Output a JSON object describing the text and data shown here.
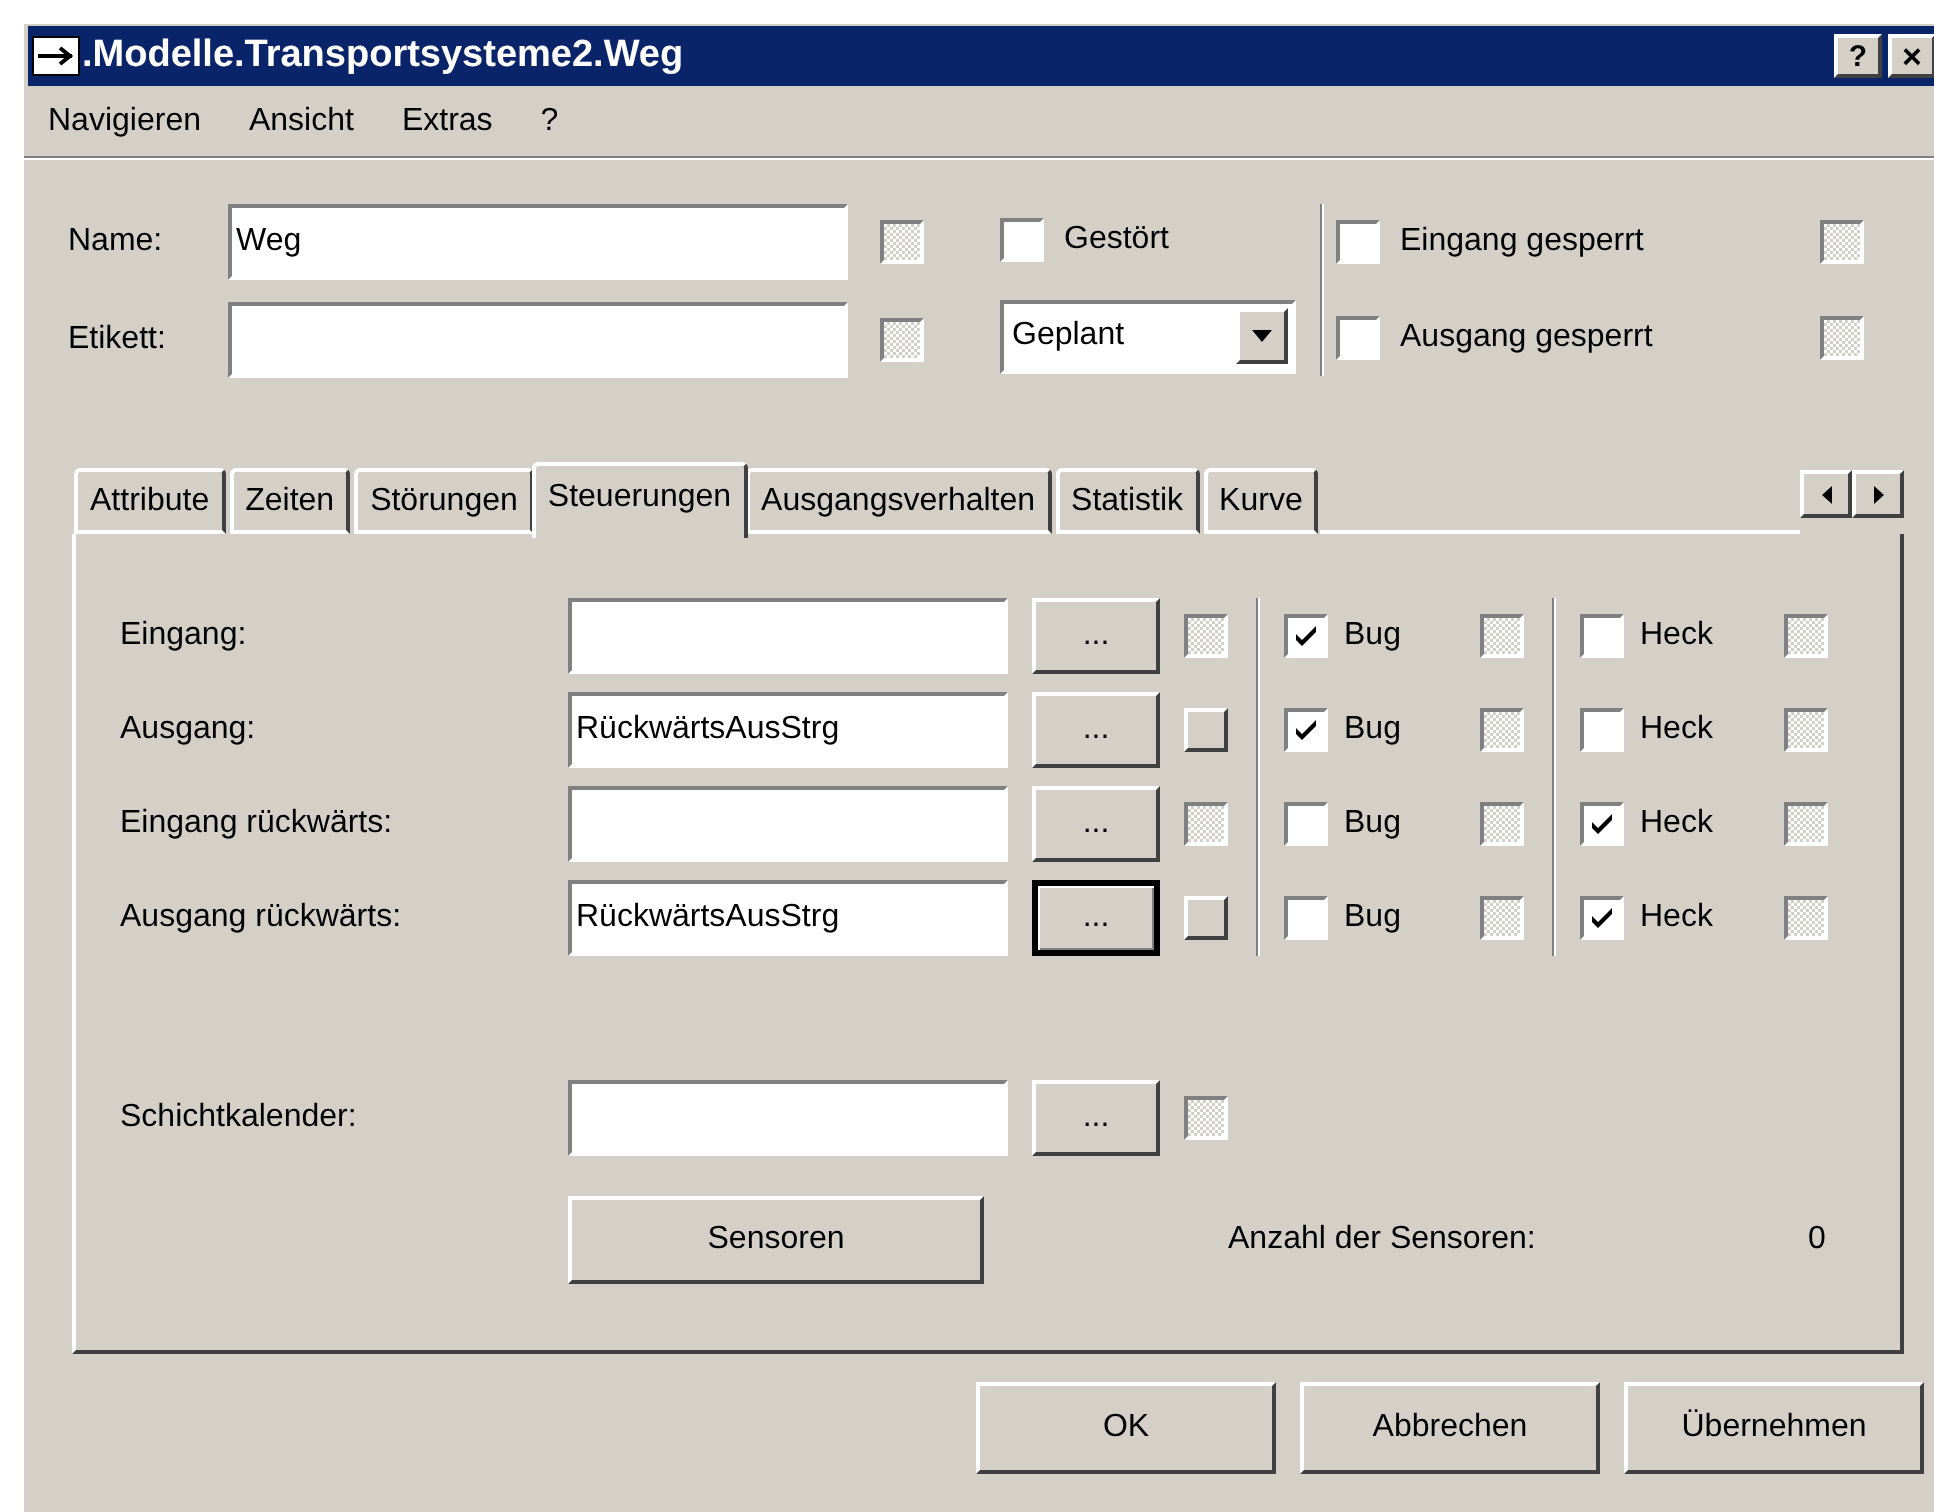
{
  "window": {
    "title": ".Modelle.Transportsysteme2.Weg",
    "help_button": "?",
    "close_button": "×"
  },
  "menu": [
    "Navigieren",
    "Ansicht",
    "Extras",
    "?"
  ],
  "header": {
    "name": {
      "label": "Name:",
      "value": "Weg",
      "inherit_disabled": true
    },
    "etikett": {
      "label": "Etikett:",
      "inherit_disabled": true
    },
    "gestoert": {
      "label": "Gestört",
      "checked": false
    },
    "status": {
      "value": "Geplant"
    },
    "eingang_gesperrt": {
      "label": "Eingang gesperrt",
      "checked": false,
      "inherit_disabled": true
    },
    "ausgang_gesperrt": {
      "label": "Ausgang gesperrt",
      "checked": false,
      "inherit_disabled": true
    }
  },
  "tabs": [
    {
      "label": "Attribute",
      "selected": false
    },
    {
      "label": "Zeiten",
      "selected": false
    },
    {
      "label": "Störungen",
      "selected": false
    },
    {
      "label": "Steuerungen",
      "selected": true
    },
    {
      "label": "Ausgangsverhalten",
      "selected": false
    },
    {
      "label": "Statistik",
      "selected": false
    },
    {
      "label": "Kurve",
      "selected": false
    }
  ],
  "controls": [
    {
      "label": "Eingang:",
      "button": "...",
      "focused": false,
      "inherit_disabled": true,
      "bug": {
        "label": "Bug",
        "checked": true,
        "inherit_disabled": true
      },
      "heck": {
        "label": "Heck",
        "checked": false,
        "inherit_disabled": true
      }
    },
    {
      "label": "Ausgang:",
      "value": "RückwärtsAusStrg",
      "button": "...",
      "focused": false,
      "inherit_disabled": false,
      "bug": {
        "label": "Bug",
        "checked": true,
        "inherit_disabled": true
      },
      "heck": {
        "label": "Heck",
        "checked": false,
        "inherit_disabled": true
      }
    },
    {
      "label": "Eingang rückwärts:",
      "button": "...",
      "focused": false,
      "inherit_disabled": true,
      "bug": {
        "label": "Bug",
        "checked": false,
        "inherit_disabled": true
      },
      "heck": {
        "label": "Heck",
        "checked": true,
        "inherit_disabled": true
      }
    },
    {
      "label": "Ausgang rückwärts:",
      "value": "RückwärtsAusStrg",
      "button": "...",
      "focused": true,
      "inherit_disabled": false,
      "bug": {
        "label": "Bug",
        "checked": false,
        "inherit_disabled": true
      },
      "heck": {
        "label": "Heck",
        "checked": true,
        "inherit_disabled": true
      }
    }
  ],
  "schichtkalender": {
    "label": "Schichtkalender:",
    "button": "...",
    "inherit_disabled": true
  },
  "sensoren_button": "Sensoren",
  "sensor_count": {
    "label": "Anzahl der Sensoren:",
    "value": "0"
  },
  "buttons": [
    "OK",
    "Abbrechen",
    "Übernehmen"
  ]
}
